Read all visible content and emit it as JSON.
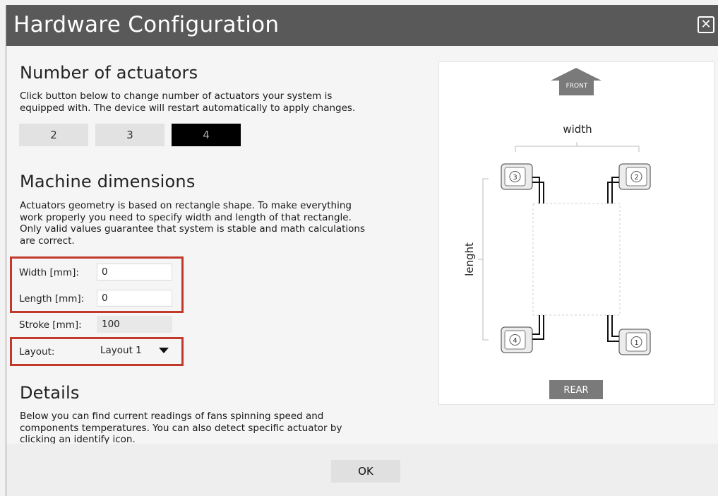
{
  "window": {
    "title": "Hardware Configuration",
    "close_glyph": "✕"
  },
  "actuators": {
    "heading": "Number of actuators",
    "description_lines": [
      "Click button below to change number of actuators your system is",
      "equipped with. The device will restart automatically to apply changes."
    ],
    "options": [
      "2",
      "3",
      "4"
    ],
    "selected": "4"
  },
  "dimensions": {
    "heading": "Machine dimensions",
    "description_lines": [
      "Actuators geometry is based on rectangle shape. To make everything",
      "work properly you need to specify width and length of that rectangle.",
      "Only valid values guarantee that system is stable and math calculations",
      "are correct."
    ],
    "width": {
      "label": "Width [mm]:",
      "value": "0"
    },
    "length": {
      "label": "Length [mm]:",
      "value": "0"
    },
    "stroke": {
      "label": "Stroke [mm]:",
      "value": "100"
    },
    "layout": {
      "label": "Layout:",
      "value": "Layout 1"
    }
  },
  "details": {
    "heading": "Details",
    "description_lines": [
      "Below you can find current readings of fans spinning speed and",
      "components temperatures. You can also detect specific actuator by",
      "clicking an identify icon."
    ]
  },
  "diagram": {
    "front_label": "FRONT",
    "rear_label": "REAR",
    "width_label": "width",
    "length_label": "lenght",
    "actuator_numbers": [
      "3",
      "2",
      "4",
      "1"
    ]
  },
  "footer": {
    "ok_label": "OK"
  },
  "colors": {
    "titlebar": "#595959",
    "highlight": "#c0392b",
    "active_button": "#000000"
  }
}
